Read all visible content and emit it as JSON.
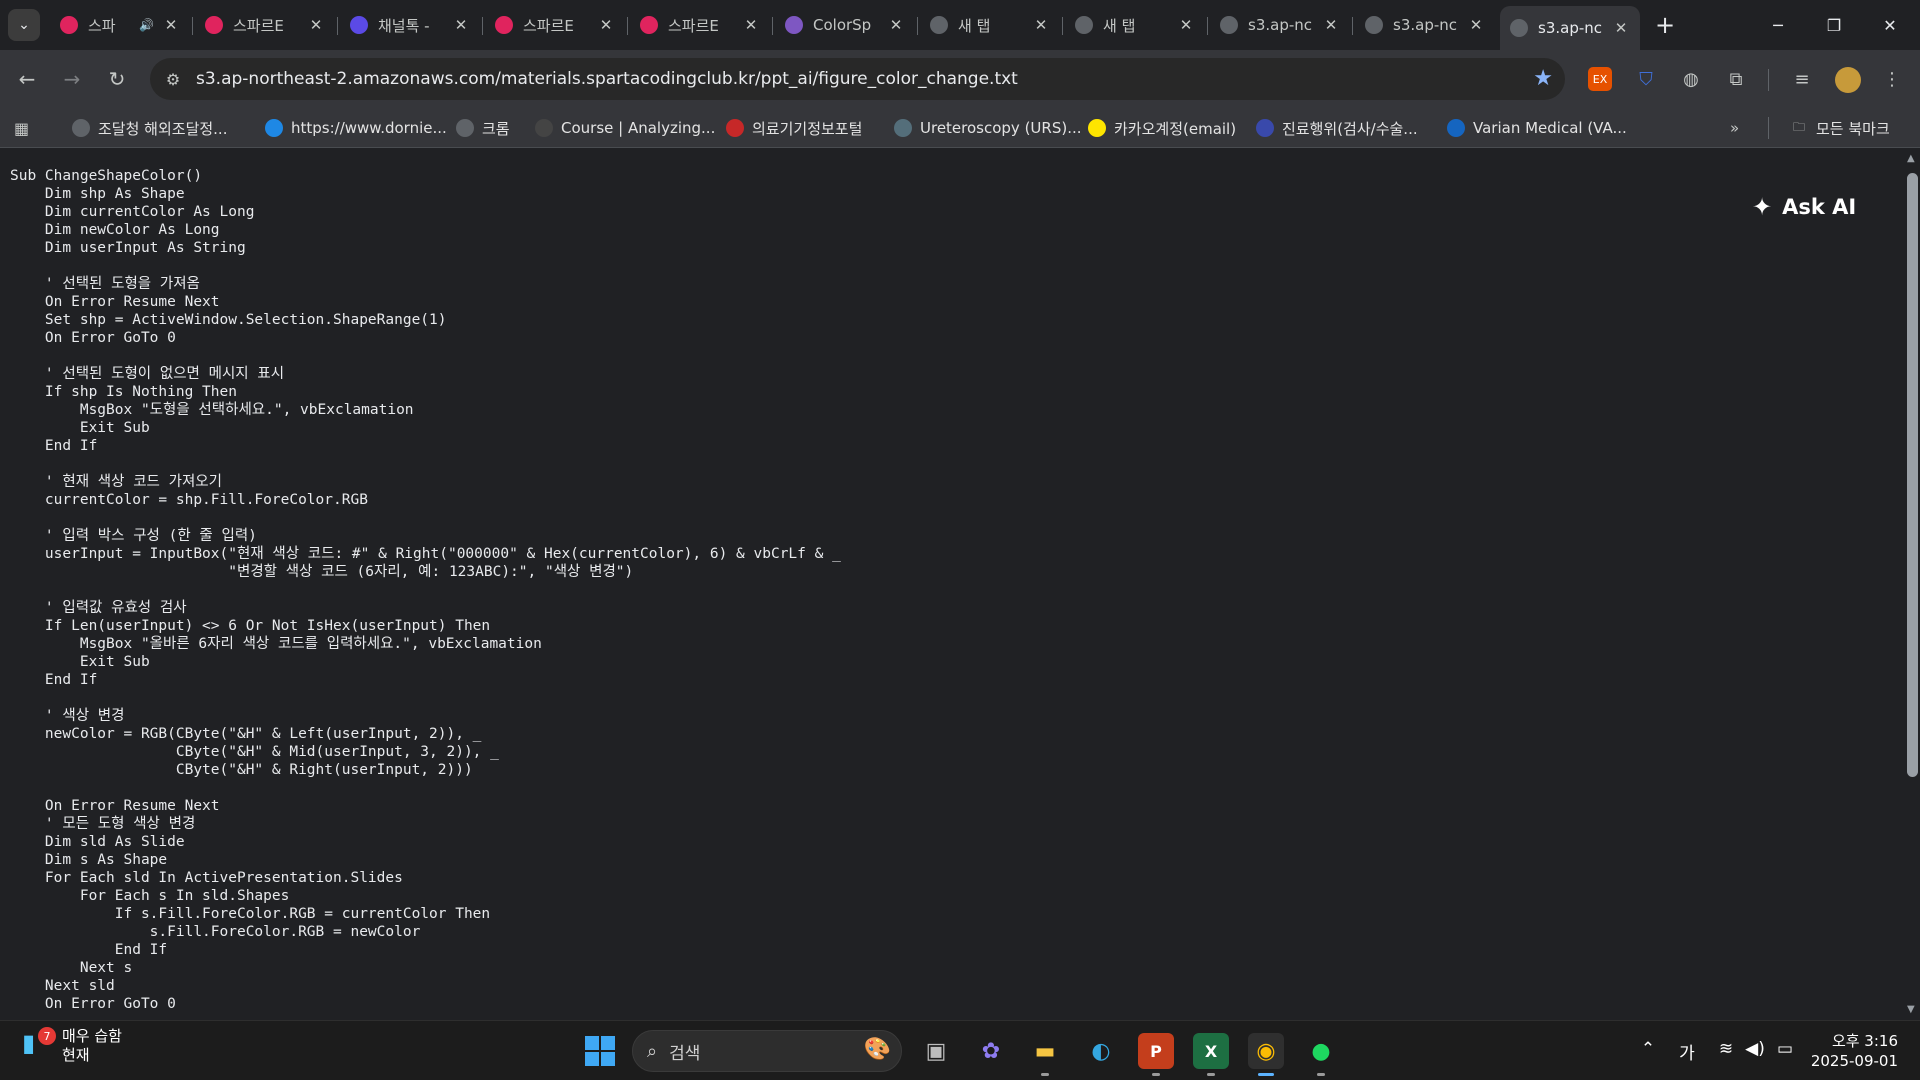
{
  "tabs": [
    {
      "label": "스파",
      "icon": "spartacoding-icon",
      "color": "#e0245e",
      "sound": true,
      "active": false
    },
    {
      "label": "스파르E",
      "icon": "spartacoding-icon",
      "color": "#e0245e",
      "active": false
    },
    {
      "label": "채널톡 -",
      "icon": "channeltalk-icon",
      "color": "#5b4ae6",
      "active": false
    },
    {
      "label": "스파르E",
      "icon": "spartacoding-icon",
      "color": "#e0245e",
      "active": false
    },
    {
      "label": "스파르E",
      "icon": "spartacoding-icon",
      "color": "#e0245e",
      "active": false
    },
    {
      "label": "ColorSp",
      "icon": "colorspace-icon",
      "color": "#7e57c2",
      "active": false
    },
    {
      "label": "새 탭",
      "icon": "chrome-icon",
      "color": "#5f6368",
      "active": false
    },
    {
      "label": "새 탭",
      "icon": "chrome-icon",
      "color": "#5f6368",
      "active": false
    },
    {
      "label": "s3.ap-nc",
      "icon": "globe-icon",
      "color": "#5f6368",
      "active": false
    },
    {
      "label": "s3.ap-nc",
      "icon": "globe-icon",
      "color": "#5f6368",
      "active": false
    },
    {
      "label": "s3.ap-nc",
      "icon": "globe-icon",
      "color": "#5f6368",
      "active": true
    }
  ],
  "address": {
    "url": "s3.ap-northeast-2.amazonaws.com/materials.spartacodingclub.kr/ppt_ai/figure_color_change.txt"
  },
  "bookmarks": [
    {
      "label": "조달청 해외조달정...",
      "icon": "globe-icon",
      "color": "#5f6368"
    },
    {
      "label": "https://www.dornie...",
      "icon": "dornier-icon",
      "color": "#1e88e5"
    },
    {
      "label": "크롬",
      "icon": "globe-icon",
      "color": "#5f6368"
    },
    {
      "label": "Course | Analyzing...",
      "icon": "edx-icon",
      "color": "#444"
    },
    {
      "label": "의료기기정보포털",
      "icon": "portal-icon",
      "color": "#c62828"
    },
    {
      "label": "Ureteroscopy (URS)...",
      "icon": "urs-icon",
      "color": "#546e7a"
    },
    {
      "label": "카카오계정(email)",
      "icon": "kakao-icon",
      "color": "#fee500"
    },
    {
      "label": "진료행위(검사/수술...",
      "icon": "medical-icon",
      "color": "#3949ab"
    },
    {
      "label": "Varian Medical (VA...",
      "icon": "varian-icon",
      "color": "#1565c0"
    }
  ],
  "bookmarks_all_label": "모든 북마크",
  "extensions": {
    "ex_label": "EX"
  },
  "document": {
    "text": "Sub ChangeShapeColor()\n    Dim shp As Shape\n    Dim currentColor As Long\n    Dim newColor As Long\n    Dim userInput As String\n\n    ' 선택된 도형을 가져옴\n    On Error Resume Next\n    Set shp = ActiveWindow.Selection.ShapeRange(1)\n    On Error GoTo 0\n\n    ' 선택된 도형이 없으면 메시지 표시\n    If shp Is Nothing Then\n        MsgBox \"도형을 선택하세요.\", vbExclamation\n        Exit Sub\n    End If\n\n    ' 현재 색상 코드 가져오기\n    currentColor = shp.Fill.ForeColor.RGB\n\n    ' 입력 박스 구성 (한 줄 입력)\n    userInput = InputBox(\"현재 색상 코드: #\" & Right(\"000000\" & Hex(currentColor), 6) & vbCrLf & _\n                         \"변경할 색상 코드 (6자리, 예: 123ABC):\", \"색상 변경\")\n\n    ' 입력값 유효성 검사\n    If Len(userInput) <> 6 Or Not IsHex(userInput) Then\n        MsgBox \"올바른 6자리 색상 코드를 입력하세요.\", vbExclamation\n        Exit Sub\n    End If\n\n    ' 색상 변경\n    newColor = RGB(CByte(\"&H\" & Left(userInput, 2)), _\n                   CByte(\"&H\" & Mid(userInput, 3, 2)), _\n                   CByte(\"&H\" & Right(userInput, 2)))\n\n    On Error Resume Next\n    ' 모든 도형 색상 변경\n    Dim sld As Slide\n    Dim s As Shape\n    For Each sld In ActivePresentation.Slides\n        For Each s In sld.Shapes\n            If s.Fill.ForeColor.RGB = currentColor Then\n                s.Fill.ForeColor.RGB = newColor\n            End If\n        Next s\n    Next sld\n    On Error GoTo 0"
  },
  "ask_ai_label": "Ask AI",
  "taskbar": {
    "weather_badge": "7",
    "weather_condition": "매우 습함",
    "weather_sub": "현재",
    "search_placeholder": "검색",
    "ime_label": "가",
    "time": "오후 3:16",
    "date": "2025-09-01"
  }
}
